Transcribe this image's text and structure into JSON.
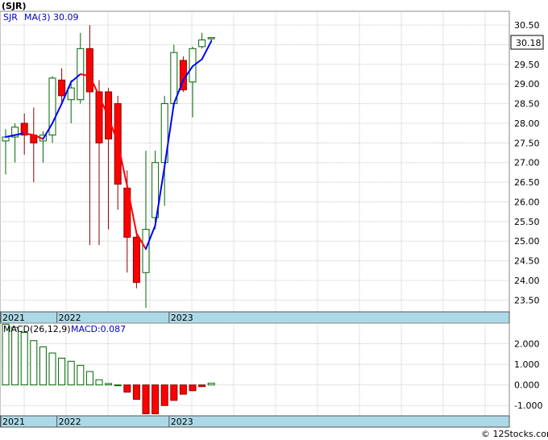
{
  "ticker_label": "(SJR)",
  "legend": {
    "sym": "SJR",
    "ma_label": "MA(3)",
    "ma_value": "30.09"
  },
  "macd_legend": {
    "label": "MACD(26,12,9)",
    "value_label": "MACD:0.087"
  },
  "price_badge": "30.18",
  "watermark": "© 12Stocks.com",
  "colors": {
    "up": "#006600",
    "down": "#ff0000",
    "ma_rising": "#0000ff",
    "ma_falling": "#ff0000",
    "grid": "#c8c8c8",
    "axis_band": "#add8e6"
  },
  "chart_data": [
    {
      "type": "candlestick",
      "title": "(SJR)",
      "price_scale_ticks": [
        "30.50",
        "30.00",
        "29.50",
        "29.00",
        "28.50",
        "28.00",
        "27.50",
        "27.00",
        "26.50",
        "26.00",
        "25.50",
        "25.00",
        "24.50",
        "24.00",
        "23.50"
      ],
      "ylim": [
        23.2,
        30.85
      ],
      "x_labels": [
        {
          "label": "2021",
          "index": 0
        },
        {
          "label": "2022",
          "index": 6
        },
        {
          "label": "2023",
          "index": 18
        }
      ],
      "last_price": 30.18,
      "candles": [
        {
          "o": 27.55,
          "h": 27.85,
          "l": 26.7,
          "c": 27.65
        },
        {
          "o": 27.65,
          "h": 28.0,
          "l": 27.0,
          "c": 27.9
        },
        {
          "o": 28.0,
          "h": 28.25,
          "l": 27.2,
          "c": 27.7
        },
        {
          "o": 27.7,
          "h": 28.4,
          "l": 26.5,
          "c": 27.5
        },
        {
          "o": 27.55,
          "h": 27.8,
          "l": 27.0,
          "c": 27.7
        },
        {
          "o": 27.7,
          "h": 29.2,
          "l": 27.5,
          "c": 29.15
        },
        {
          "o": 29.1,
          "h": 29.4,
          "l": 28.5,
          "c": 28.7
        },
        {
          "o": 28.6,
          "h": 29.1,
          "l": 28.0,
          "c": 28.9
        },
        {
          "o": 28.6,
          "h": 30.3,
          "l": 28.5,
          "c": 29.9
        },
        {
          "o": 29.9,
          "h": 30.5,
          "l": 24.9,
          "c": 28.8
        },
        {
          "o": 28.8,
          "h": 29.1,
          "l": 24.9,
          "c": 27.5
        },
        {
          "o": 28.8,
          "h": 28.9,
          "l": 25.3,
          "c": 27.6
        },
        {
          "o": 28.5,
          "h": 28.7,
          "l": 25.8,
          "c": 26.45
        },
        {
          "o": 26.35,
          "h": 26.8,
          "l": 24.2,
          "c": 25.1
        },
        {
          "o": 25.1,
          "h": 25.2,
          "l": 23.8,
          "c": 23.95
        },
        {
          "o": 24.2,
          "h": 27.3,
          "l": 23.3,
          "c": 25.3
        },
        {
          "o": 25.6,
          "h": 27.3,
          "l": 25.3,
          "c": 27.0
        },
        {
          "o": 27.0,
          "h": 28.7,
          "l": 25.9,
          "c": 28.5
        },
        {
          "o": 28.5,
          "h": 30.0,
          "l": 28.4,
          "c": 29.8
        },
        {
          "o": 29.6,
          "h": 29.7,
          "l": 28.8,
          "c": 28.85
        },
        {
          "o": 29.05,
          "h": 29.95,
          "l": 28.15,
          "c": 29.9
        },
        {
          "o": 29.95,
          "h": 30.3,
          "l": 29.9,
          "c": 30.12
        },
        {
          "o": 30.15,
          "h": 30.18,
          "l": 30.1,
          "c": 30.18
        }
      ],
      "ma3": [
        27.65,
        27.7,
        27.75,
        27.7,
        27.6,
        28.0,
        28.5,
        29.05,
        29.25,
        29.2,
        28.7,
        28.15,
        27.5,
        26.4,
        25.2,
        24.8,
        25.4,
        26.9,
        28.5,
        29.1,
        29.45,
        29.63,
        30.09
      ]
    },
    {
      "type": "bar",
      "title": "MACD(26,12,9)",
      "value_ticks": [
        "2.000",
        "1.000",
        "0.000",
        "-1.000"
      ],
      "ylim": [
        -1.5,
        3.0
      ],
      "x_labels": [
        {
          "label": "2021",
          "index": 0
        },
        {
          "label": "2022",
          "index": 6
        },
        {
          "label": "2023",
          "index": 18
        }
      ],
      "values": [
        2.95,
        2.8,
        2.55,
        2.15,
        1.85,
        1.55,
        1.3,
        1.15,
        0.95,
        0.65,
        0.25,
        0.07,
        0.0,
        -0.35,
        -0.7,
        -1.4,
        -1.4,
        -1.0,
        -0.75,
        -0.45,
        -0.28,
        -0.08,
        0.087
      ]
    }
  ]
}
